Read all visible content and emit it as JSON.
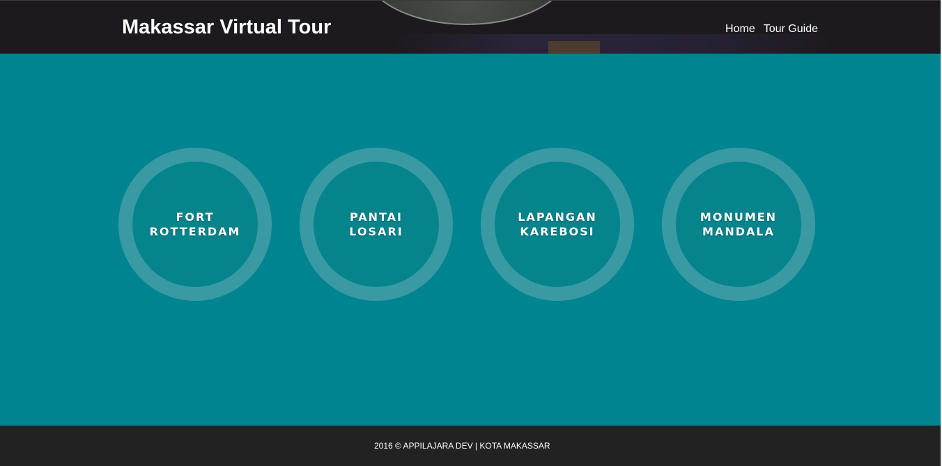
{
  "header": {
    "title": "Makassar Virtual Tour",
    "nav": [
      {
        "label": "Home"
      },
      {
        "label": "Tour Guide"
      }
    ]
  },
  "destinations": [
    {
      "label": "FORT\nROTTERDAM"
    },
    {
      "label": "PANTAI\nLOSARI"
    },
    {
      "label": "LAPANGAN\nKAREBOSI"
    },
    {
      "label": "MONUMEN\nMANDALA"
    }
  ],
  "footer": {
    "text": "2016 © APPILAJARA DEV | KOTA MAKASSAR"
  },
  "colors": {
    "header_bg": "#1c1a1e",
    "main_bg": "#008490",
    "circle_ring": "#3a9aa4",
    "circle_inner": "#05848c",
    "footer_bg": "#222222"
  }
}
